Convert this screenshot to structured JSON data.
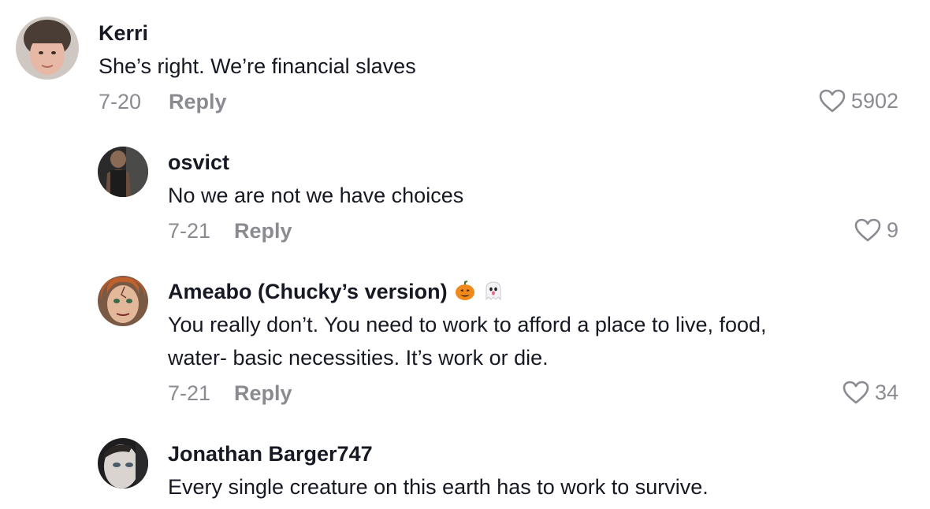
{
  "comments": [
    {
      "username": "Kerri",
      "text_lines": [
        "She’s right. We’re financial slaves"
      ],
      "date": "7-20",
      "reply_label": "Reply",
      "likes": "5902",
      "avatar": "avatar-kerri"
    },
    {
      "username": "osvict",
      "text_lines": [
        "No we are not we have choices"
      ],
      "date": "7-21",
      "reply_label": "Reply",
      "likes": "9",
      "avatar": "avatar-osvict"
    },
    {
      "username": "Ameabo (Chucky’s version)",
      "username_emojis": [
        "pumpkin-icon",
        "ghost-icon"
      ],
      "text_lines": [
        "You really don’t. You need to work to afford a place to live, food,",
        "water- basic necessities. It’s work or die."
      ],
      "date": "7-21",
      "reply_label": "Reply",
      "likes": "34",
      "avatar": "avatar-ameabo"
    },
    {
      "username": "Jonathan Barger747",
      "text_lines": [
        "Every single creature on this earth has to work to survive."
      ],
      "avatar": "avatar-jonathan"
    }
  ],
  "colors": {
    "text": "#161823",
    "muted": "#8a8b91",
    "background": "#ffffff"
  }
}
